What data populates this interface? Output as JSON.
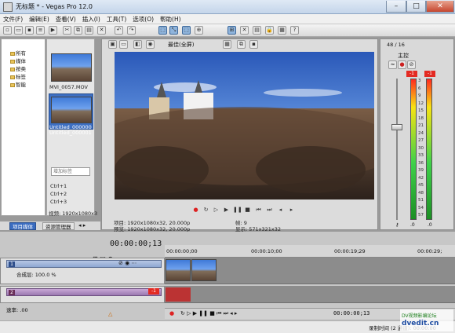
{
  "window": {
    "title": "无标题 * - Vegas Pro 12.0",
    "minimize": "–",
    "maximize": "□",
    "close": "✕"
  },
  "menu": [
    "文件(F)",
    "编辑(E)",
    "查看(V)",
    "插入(I)",
    "工具(T)",
    "选项(O)",
    "帮助(H)"
  ],
  "project_tree": [
    "所有",
    "媒体",
    "按类",
    "标签",
    "智能"
  ],
  "media": [
    {
      "label": "MVI_0057.MOV"
    },
    {
      "label": "Untitled_000000",
      "label2": "Untitled_000001"
    }
  ],
  "tag_input": {
    "placeholder": "增加标签"
  },
  "shortcuts": [
    "Ctrl+1",
    "Ctrl+2",
    "Ctrl+3"
  ],
  "video_info_left": "视频: 1920x1080x3",
  "tabs": [
    "项目媒体",
    "资源管理器"
  ],
  "preview": {
    "quality": "最佳(全屏)",
    "project_line": "项目: 1920x1080x32, 20.000p",
    "preview_line": "预览: 1920x1080x32, 20.000p",
    "frame_line": "帧: 9",
    "display_line": "显示: 571x321x32"
  },
  "master": {
    "label": "主控",
    "readout": "48 / 16",
    "peak_left": "-1",
    "peak_right": "-1",
    "scale": [
      "3",
      "6",
      "9",
      "12",
      "15",
      "18",
      "21",
      "24",
      "27",
      "30",
      "33",
      "36",
      "39",
      "42",
      "45",
      "48",
      "51",
      "54",
      "57"
    ],
    "bottom_left": ".0",
    "bottom_right": ".0"
  },
  "timeline": {
    "timecode": "00:00:00;13",
    "ruler": [
      "00:00:00;00",
      "00:00:10;00",
      "00:00:19;29",
      "00:00:29;"
    ],
    "track1": {
      "number": "1",
      "composite_label": "合成层: 100.0 %"
    },
    "track2": {
      "number": "2",
      "level": "-1"
    },
    "rate_label": "速率: .00",
    "bottom_timecode": "00:00:00;13"
  },
  "status": {
    "record_time": "录制时间 (2 通道): 00:00:00"
  },
  "watermark": {
    "text": "DV视频影编论坛",
    "url": "dvedit.cn"
  }
}
